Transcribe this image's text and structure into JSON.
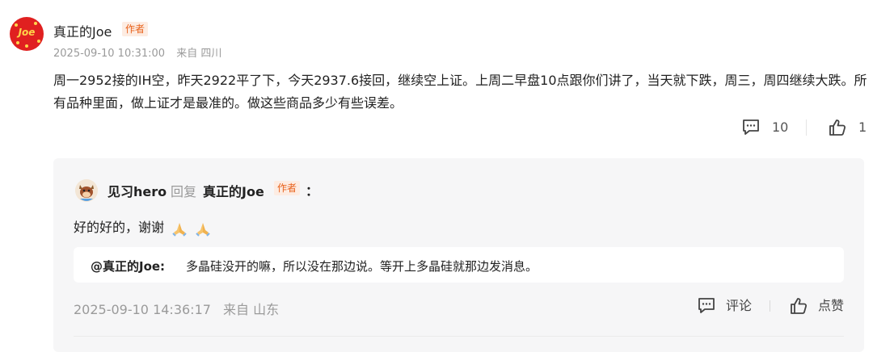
{
  "post": {
    "author": "真正的Joe",
    "author_badge": "作者",
    "avatar_text": "Joe",
    "timestamp": "2025-09-10 10:31:00",
    "location": "来自 四川",
    "content": "周一2952接的IH空，昨天2922平了下，今天2937.6接回，继续空上证。上周二早盘10点跟你们讲了，当天就下跌，周三，周四继续大跌。所有品种里面，做上证才是最准的。做这些商品多少有些误差。",
    "comment_count": "10",
    "like_count": "1"
  },
  "reply": {
    "author": "见习hero",
    "reply_word": "回复",
    "target": "真正的Joe",
    "target_badge": "作者",
    "colon": "：",
    "text": "好的好的，谢谢",
    "quote_name": "@真正的Joe:",
    "quote_text": "多晶硅没开的嘛，所以没在那边说。等开上多晶硅就那边发消息。",
    "timestamp": "2025-09-10 14:36:17",
    "location": "来自 山东",
    "comment_label": "评论",
    "like_label": "点赞"
  },
  "colors": {
    "badge_text": "#e8611a",
    "badge_bg": "#fdece2",
    "avatar_red": "#e02020",
    "reply_bg": "#f6f6f7"
  },
  "icons": [
    "comment-icon",
    "thumbs-up-icon",
    "folded-hands-emoji"
  ]
}
